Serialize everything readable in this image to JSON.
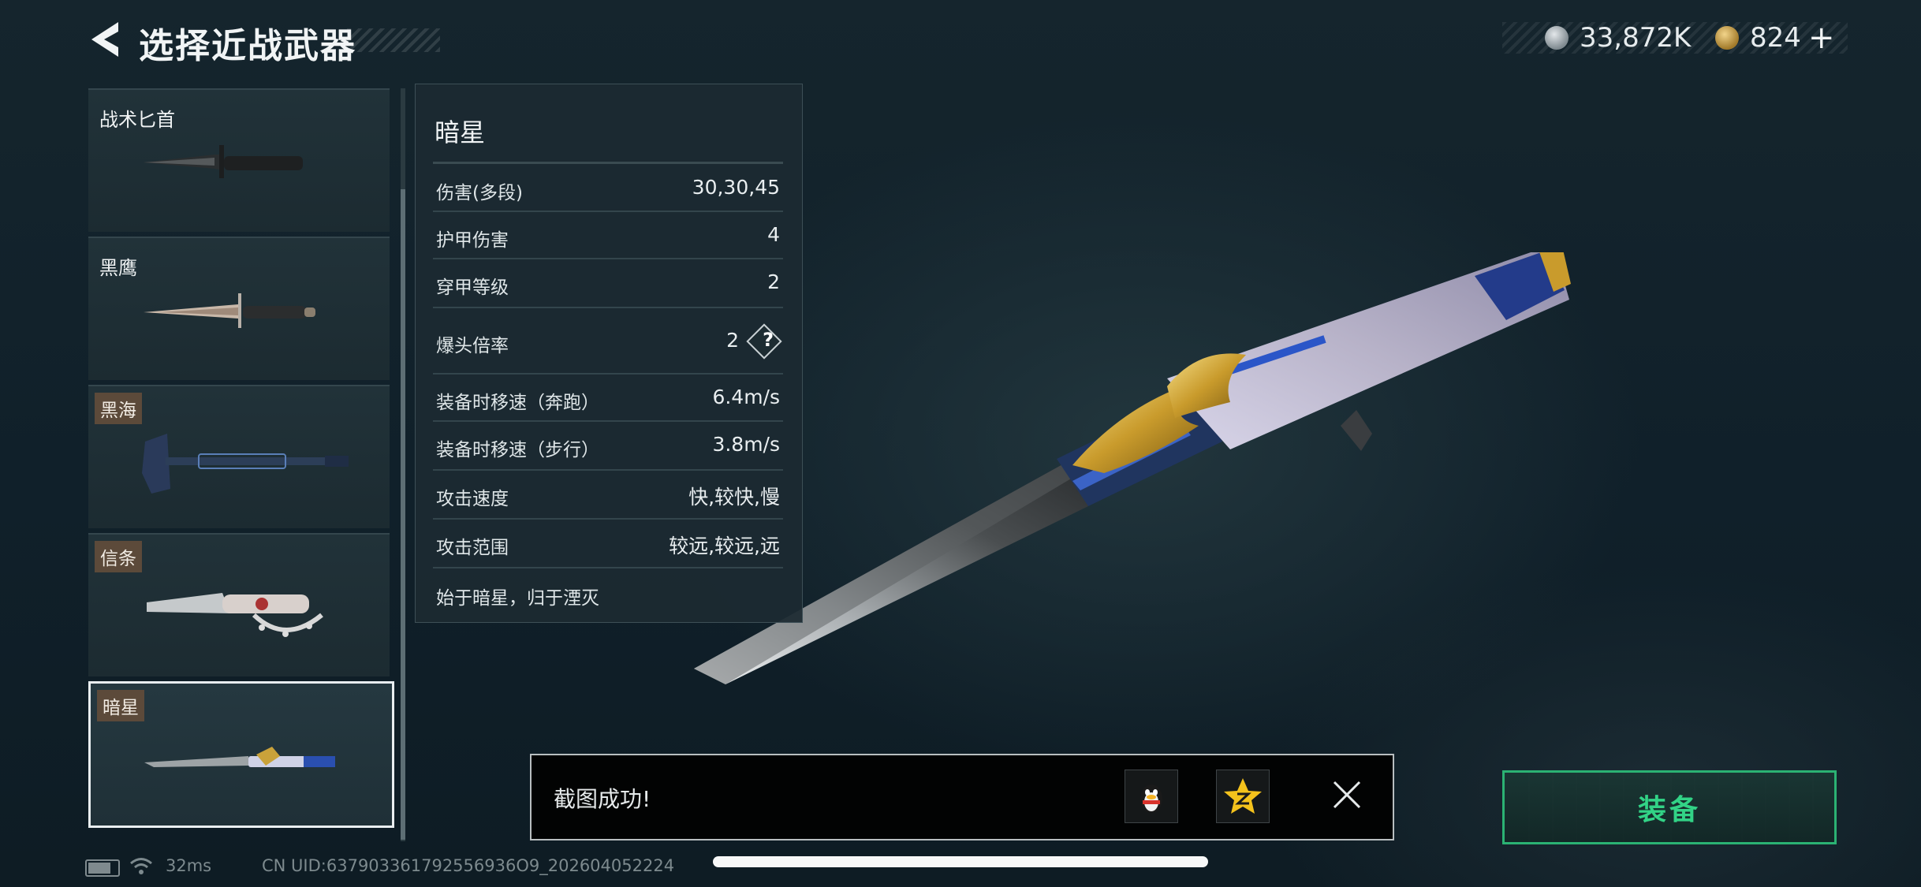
{
  "header": {
    "title": "选择近战武器",
    "currency": [
      {
        "icon": "silver-coin-icon",
        "value": "33,872K"
      },
      {
        "icon": "gold-coin-icon",
        "value": "824"
      }
    ],
    "add_symbol": "+"
  },
  "weapon_list": [
    {
      "name": "战术匕首",
      "tag": false,
      "selected": false
    },
    {
      "name": "黑鹰",
      "tag": false,
      "selected": false
    },
    {
      "name": "黑海",
      "tag": true,
      "selected": false
    },
    {
      "name": "信条",
      "tag": true,
      "selected": false
    },
    {
      "name": "暗星",
      "tag": true,
      "selected": true
    }
  ],
  "detail": {
    "name": "暗星",
    "stats": [
      {
        "label": "伤害(多段)",
        "value": "30,30,45"
      },
      {
        "label": "护甲伤害",
        "value": "4"
      },
      {
        "label": "穿甲等级",
        "value": "2"
      },
      {
        "label": "爆头倍率",
        "value": "2"
      },
      {
        "label": "装备时移速（奔跑）",
        "value": "6.4m/s"
      },
      {
        "label": "装备时移速（步行）",
        "value": "3.8m/s"
      },
      {
        "label": "攻击速度",
        "value": "快,较快,慢"
      },
      {
        "label": "攻击范围",
        "value": "较远,较远,远"
      }
    ],
    "help_symbol": "?",
    "quote": "始于暗星，归于湮灭"
  },
  "toast": {
    "message": "截图成功!"
  },
  "equip_button": {
    "label": "装备",
    "accent": "#32d386"
  },
  "footer": {
    "ping": "32ms",
    "uid": "CN UID:637903361792556936O9_202604052224"
  }
}
